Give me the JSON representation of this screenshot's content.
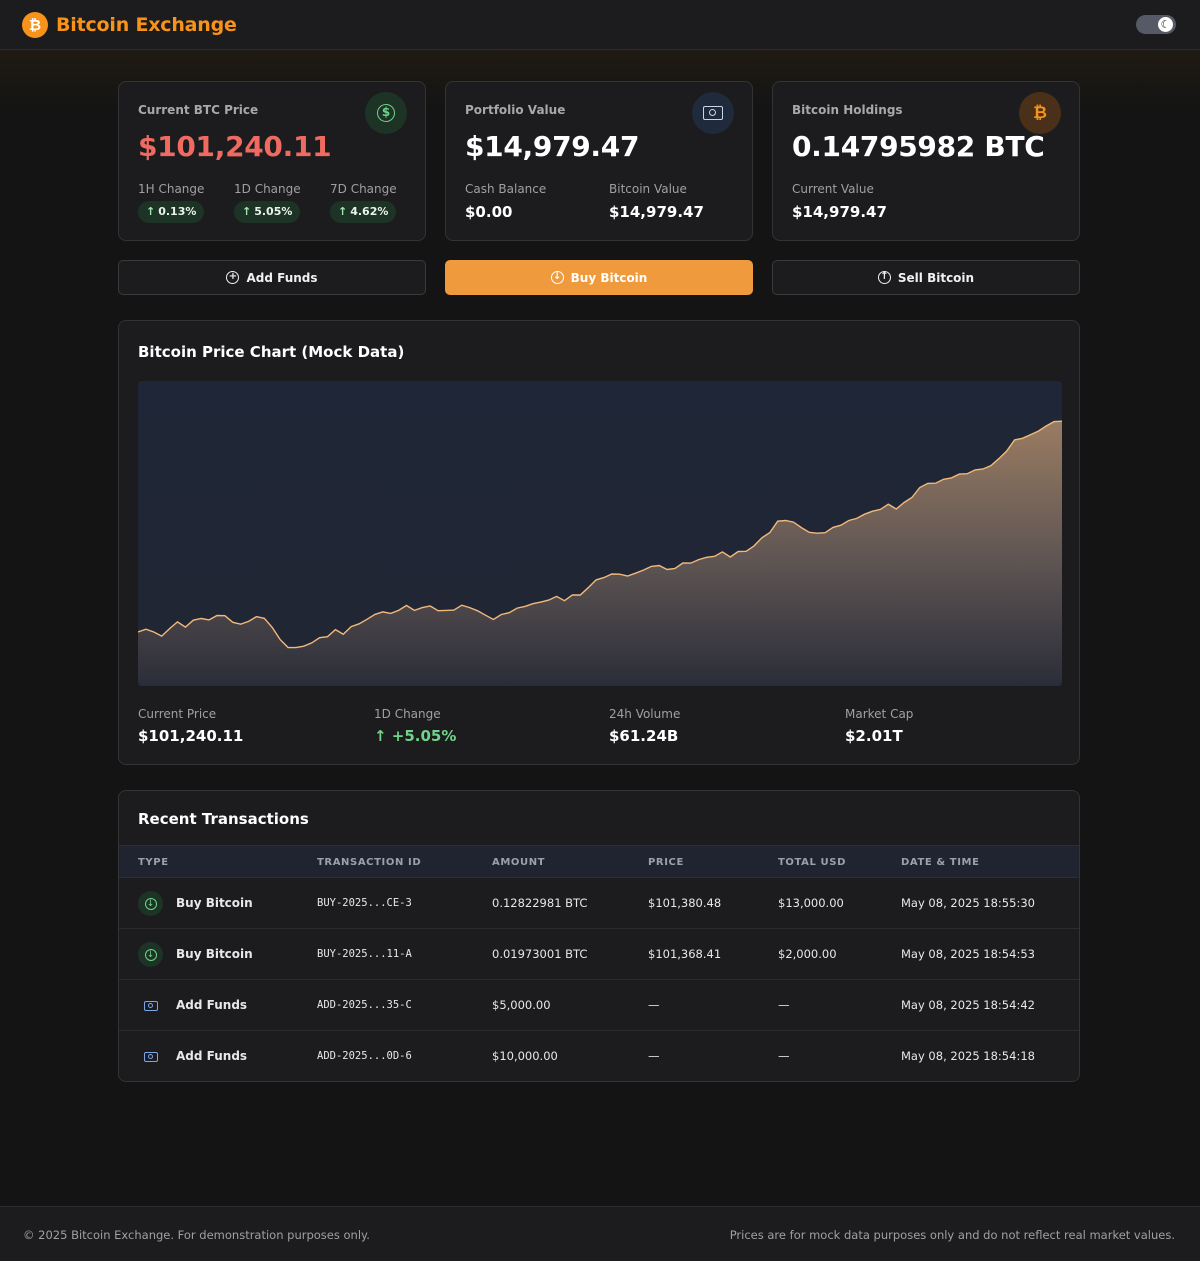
{
  "header": {
    "brand_icon": "₿",
    "brand_title": "Bitcoin Exchange",
    "theme_toggle_icon": "moon-icon",
    "theme_toggle_glyph": "☾"
  },
  "cards": {
    "price": {
      "label": "Current BTC Price",
      "value": "$101,240.11",
      "icon": "dollar-circle-icon",
      "icon_glyph": "$",
      "changes": [
        {
          "label": "1H Change",
          "value": "0.13%",
          "arrow": "↑"
        },
        {
          "label": "1D Change",
          "value": "5.05%",
          "arrow": "↑"
        },
        {
          "label": "7D Change",
          "value": "4.62%",
          "arrow": "↑"
        }
      ]
    },
    "portfolio": {
      "label": "Portfolio Value",
      "value": "$14,979.47",
      "icon": "banknote-icon",
      "icon_glyph": "▣",
      "cash_label": "Cash Balance",
      "cash_value": "$0.00",
      "btc_label": "Bitcoin Value",
      "btc_value": "$14,979.47"
    },
    "holdings": {
      "label": "Bitcoin Holdings",
      "value": "0.14795982 BTC",
      "icon": "bitcoin-icon",
      "icon_glyph": "₿",
      "current_label": "Current Value",
      "current_value": "$14,979.47"
    }
  },
  "actions": {
    "add_funds": {
      "label": "Add Funds",
      "icon": "plus-circle-icon",
      "glyph": "+"
    },
    "buy": {
      "label": "Buy Bitcoin",
      "icon": "arrow-down-circle-icon",
      "glyph": "↓"
    },
    "sell": {
      "label": "Sell Bitcoin",
      "icon": "arrow-up-circle-icon",
      "glyph": "↑"
    }
  },
  "chart_section": {
    "title": "Bitcoin Price Chart (Mock Data)",
    "metrics": [
      {
        "label": "Current Price",
        "value": "$101,240.11"
      },
      {
        "label": "1D Change",
        "value": "↑ +5.05%"
      },
      {
        "label": "24h Volume",
        "value": "$61.24B"
      },
      {
        "label": "Market Cap",
        "value": "$2.01T"
      }
    ]
  },
  "chart_data": {
    "type": "area",
    "title": "",
    "xlabel": "",
    "ylabel": "",
    "grid": false,
    "legend": "none",
    "line_color": "#f2b97a",
    "values": [
      18.5,
      19.5,
      18.0,
      17.0,
      19.0,
      22.0,
      20.0,
      22.5,
      23.0,
      22.0,
      24.0,
      23.5,
      22.0,
      21.0,
      22.0,
      23.5,
      22.5,
      20.0,
      15.5,
      13.5,
      13.0,
      13.5,
      14.5,
      16.0,
      17.0,
      19.0,
      18.0,
      20.0,
      21.0,
      22.5,
      24.0,
      25.5,
      24.5,
      26.0,
      27.0,
      25.5,
      26.5,
      27.0,
      26.0,
      25.5,
      26.0,
      27.0,
      26.5,
      25.5,
      24.0,
      23.0,
      24.0,
      25.0,
      26.0,
      27.0,
      28.0,
      28.5,
      29.5,
      30.0,
      29.0,
      30.5,
      31.0,
      33.5,
      36.0,
      37.0,
      37.5,
      38.0,
      37.0,
      38.5,
      39.5,
      40.5,
      41.0,
      39.0,
      40.0,
      41.5,
      42.0,
      43.0,
      43.5,
      44.0,
      45.0,
      44.0,
      45.5,
      46.0,
      47.5,
      50.0,
      52.0,
      55.5,
      56.5,
      55.5,
      54.0,
      52.0,
      51.5,
      52.0,
      53.5,
      55.0,
      56.0,
      57.0,
      58.0,
      59.0,
      60.0,
      61.5,
      60.5,
      62.0,
      64.0,
      67.0,
      68.5,
      69.0,
      70.0,
      71.0,
      71.5,
      72.0,
      73.0,
      73.5,
      75.0,
      77.0,
      80.0,
      83.0,
      84.0,
      85.0,
      86.5,
      88.5,
      89.5,
      90.0
    ]
  },
  "transactions": {
    "title": "Recent Transactions",
    "columns": [
      "TYPE",
      "TRANSACTION ID",
      "AMOUNT",
      "PRICE",
      "TOTAL USD",
      "DATE & TIME"
    ],
    "rows": [
      {
        "type": "Buy Bitcoin",
        "icon": "buy",
        "id": "BUY-2025...CE-3",
        "amount": "0.12822981 BTC",
        "price": "$101,380.48",
        "total": "$13,000.00",
        "date": "May 08, 2025 18:55:30"
      },
      {
        "type": "Buy Bitcoin",
        "icon": "buy",
        "id": "BUY-2025...11-A",
        "amount": "0.01973001 BTC",
        "price": "$101,368.41",
        "total": "$2,000.00",
        "date": "May 08, 2025 18:54:53"
      },
      {
        "type": "Add Funds",
        "icon": "add",
        "id": "ADD-2025...35-C",
        "amount": "$5,000.00",
        "price": "—",
        "total": "—",
        "date": "May 08, 2025 18:54:42"
      },
      {
        "type": "Add Funds",
        "icon": "add",
        "id": "ADD-2025...0D-6",
        "amount": "$10,000.00",
        "price": "—",
        "total": "—",
        "date": "May 08, 2025 18:54:18"
      }
    ]
  },
  "footer": {
    "left": "© 2025 Bitcoin Exchange. For demonstration purposes only.",
    "right": "Prices are for mock data purposes only and do not reflect real market values."
  }
}
